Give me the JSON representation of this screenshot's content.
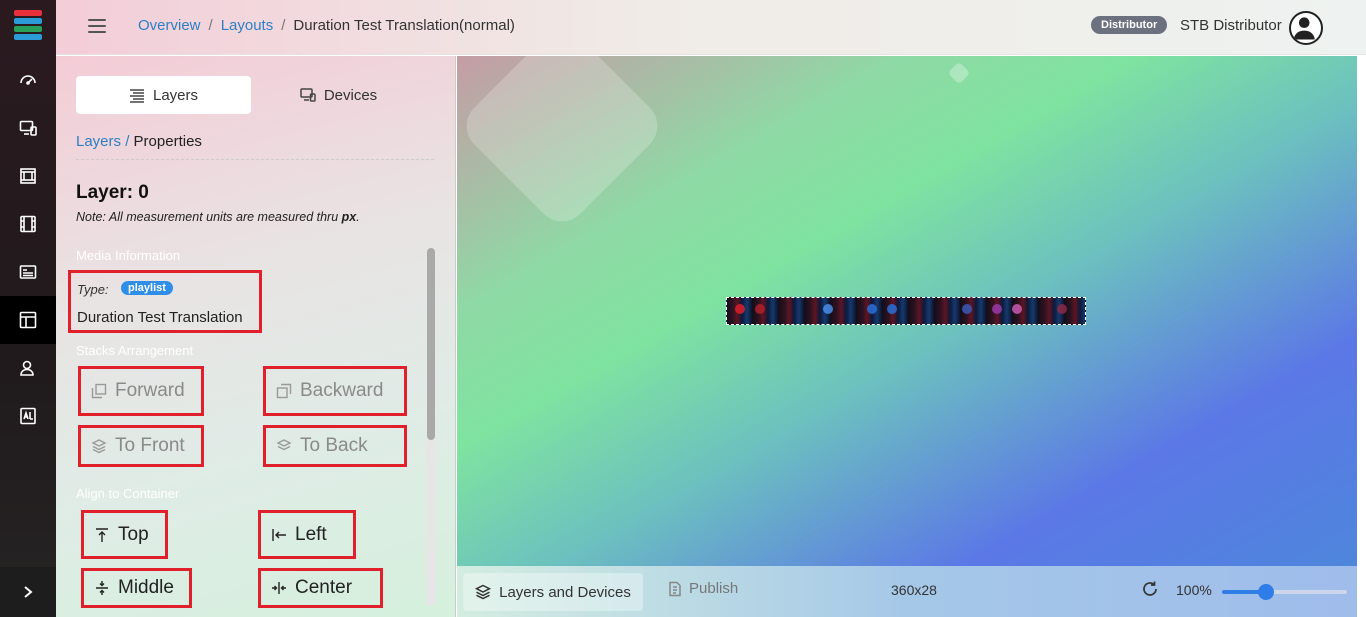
{
  "nav": {
    "items": [
      "dashboard-icon",
      "devices-icon",
      "media-icon",
      "film-icon",
      "playlist-icon",
      "layouts-icon",
      "users-icon",
      "reports-icon"
    ],
    "active": "layouts-icon"
  },
  "breadcrumb": {
    "overview": "Overview",
    "layouts": "Layouts",
    "current": "Duration Test Translation(normal)",
    "separator": "/"
  },
  "user": {
    "role_badge": "Distributor",
    "name": "STB Distributor"
  },
  "panel": {
    "tabs": [
      {
        "label": "Layers",
        "icon": "layers-icon",
        "selected": true
      },
      {
        "label": "Devices",
        "icon": "devices-icon",
        "selected": false
      }
    ],
    "crumb": {
      "link": "Layers",
      "separator": "/",
      "current": "Properties"
    },
    "layer_title": "Layer: 0",
    "note_prefix": "Note: All measurement units are measured thru ",
    "note_unit": "px",
    "note_suffix": ".",
    "media": {
      "section": "Media Information",
      "type_label": "Type:",
      "type_value": "playlist",
      "name": "Duration Test Translation"
    },
    "stacks": {
      "section": "Stacks Arrangement",
      "forward": "Forward",
      "backward": "Backward",
      "to_front": "To Front",
      "to_back": "To Back"
    },
    "align": {
      "section": "Align to Container",
      "top": "Top",
      "left": "Left",
      "middle": "Middle",
      "center": "Center"
    },
    "scroll_position": 0
  },
  "toolbar": {
    "layers_devices": "Layers and Devices",
    "publish": "Publish",
    "dimensions": "360x28",
    "zoom": "100%",
    "zoom_fraction": 0.35
  },
  "colors": {
    "accent": "#2d7fc4",
    "highlight": "#e0202a",
    "badge": "#6c7180",
    "pill": "#2f8ee8"
  }
}
